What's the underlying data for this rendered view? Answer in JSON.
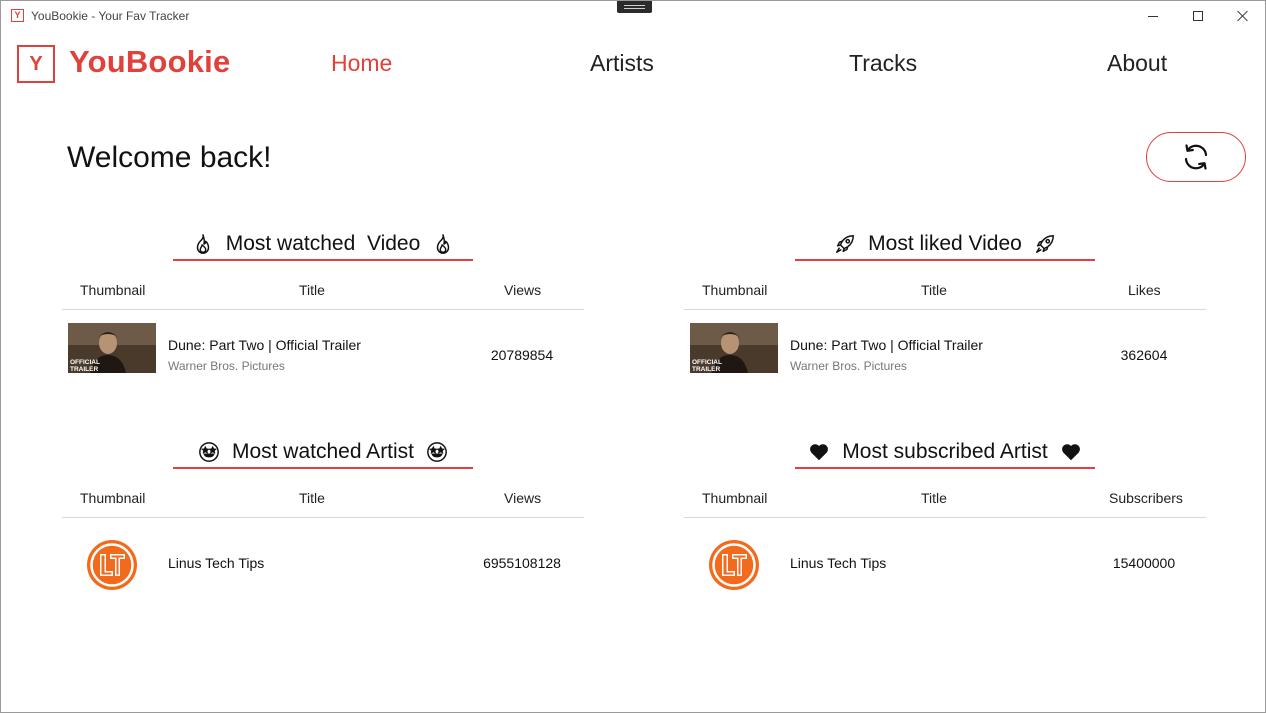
{
  "window": {
    "title": "YouBookie - Your Fav Tracker",
    "app_icon_letter": "Y"
  },
  "nav": {
    "logo_letter": "Y",
    "brand": "YouBookie",
    "links": [
      "Home",
      "Artists",
      "Tracks",
      "About"
    ],
    "active": "Home"
  },
  "main": {
    "welcome": "Welcome back!"
  },
  "colors": {
    "accent": "#e0413a",
    "channel_logo": "#f26a1b"
  },
  "panels": {
    "watched_video": {
      "title": "Most watched  Video",
      "icon": "fire-icon",
      "columns": [
        "Thumbnail",
        "Title",
        "Views"
      ],
      "row": {
        "title": "Dune: Part Two | Official Trailer",
        "channel": "Warner Bros. Pictures",
        "value": "20789854",
        "thumb_text": "OFFICIAL TRAILER"
      }
    },
    "liked_video": {
      "title": "Most liked Video",
      "icon": "rocket-icon",
      "columns": [
        "Thumbnail",
        "Title",
        "Likes"
      ],
      "row": {
        "title": "Dune: Part Two | Official Trailer",
        "channel": "Warner Bros. Pictures",
        "value": "362604",
        "thumb_text": "OFFICIAL TRAILER"
      }
    },
    "watched_artist": {
      "title": "Most watched Artist",
      "icon": "star-struck-face-icon",
      "columns": [
        "Thumbnail",
        "Title",
        "Views"
      ],
      "row": {
        "title": "Linus Tech Tips",
        "value": "6955108128"
      }
    },
    "subscribed_artist": {
      "title": "Most subscribed Artist",
      "icon": "heart-icon",
      "columns": [
        "Thumbnail",
        "Title",
        "Subscribers"
      ],
      "row": {
        "title": "Linus Tech Tips",
        "value": "15400000"
      }
    }
  }
}
